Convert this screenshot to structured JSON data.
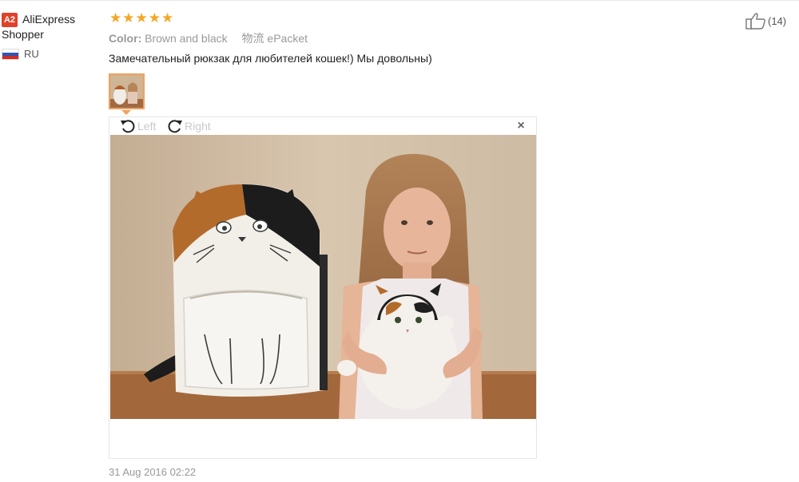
{
  "reviewer": {
    "avatar_text": "A2",
    "name_line1": "AliExpress",
    "name_line2": "Shopper",
    "country_code": "RU",
    "flag_colors": [
      "#ffffff",
      "#2d56b5",
      "#d52b1e"
    ]
  },
  "review": {
    "stars": 5,
    "star_glyph": "★",
    "color_label": "Color:",
    "color_value": "Brown and black",
    "shipping_label": "物流",
    "shipping_value": "ePacket",
    "text": "Замечательный рюкзак для любителей кошек!) Мы довольны)",
    "date": "31 Aug 2016 02:22"
  },
  "viewer": {
    "rotate_left_label": "Left",
    "rotate_right_label": "Right",
    "close_glyph": "×"
  },
  "helpful": {
    "count": "(14)"
  },
  "colors": {
    "star": "#f5a623",
    "thumb_border": "#f0a15e",
    "avatar_bg": "#e0412a"
  }
}
